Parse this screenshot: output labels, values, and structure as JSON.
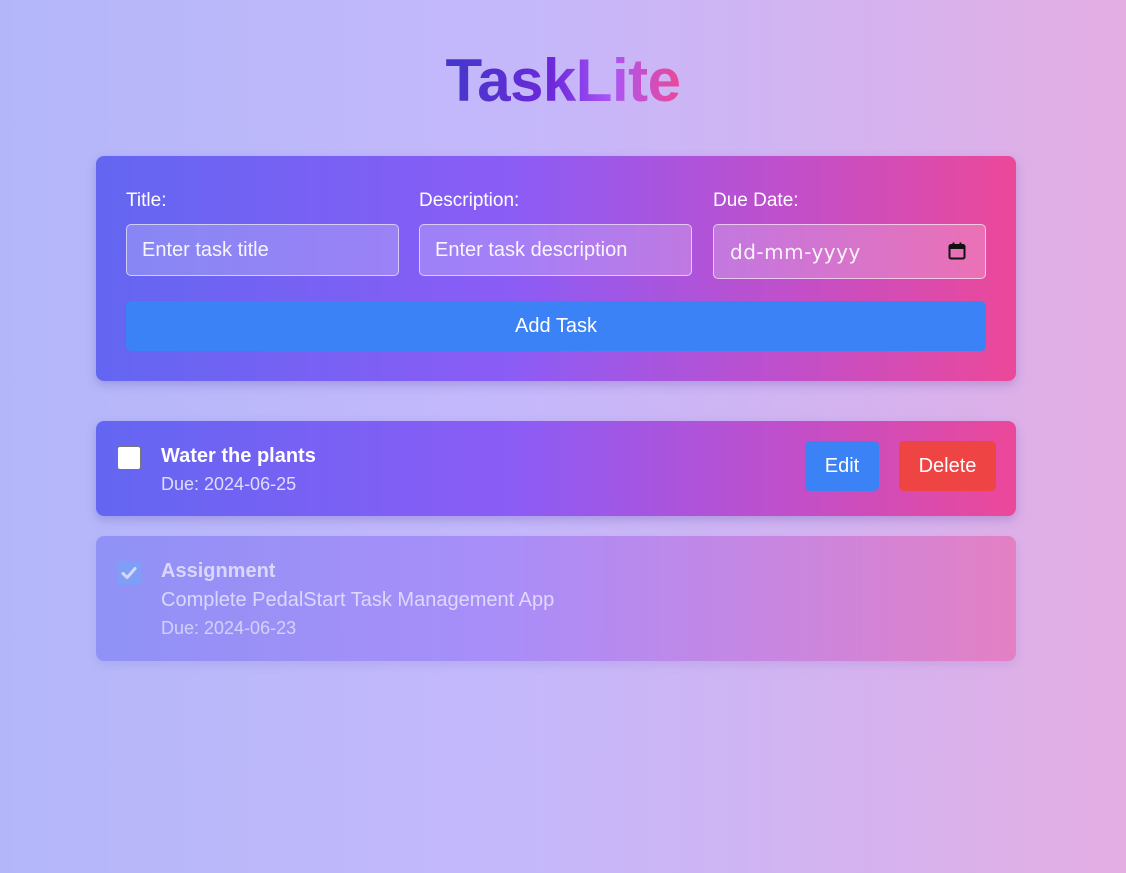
{
  "app": {
    "title": "TaskLite"
  },
  "form": {
    "title_label": "Title:",
    "title_placeholder": "Enter task title",
    "description_label": "Description:",
    "description_placeholder": "Enter task description",
    "due_label": "Due Date:",
    "due_placeholder": "dd-mm-yyyy",
    "add_button": "Add Task"
  },
  "tasks": [
    {
      "title": "Water the plants",
      "description": "",
      "due": "Due: 2024-06-25",
      "completed": false,
      "edit_label": "Edit",
      "delete_label": "Delete"
    },
    {
      "title": "Assignment",
      "description": "Complete PedalStart Task Management App",
      "due": "Due: 2024-06-23",
      "completed": true
    }
  ],
  "colors": {
    "primary_button": "#3b82f6",
    "danger_button": "#ef4444",
    "panel_gradient_start": "#6366f1",
    "panel_gradient_mid": "#8b5cf6",
    "panel_gradient_end": "#ec4899"
  },
  "icons": {
    "date_picker": "calendar-icon",
    "checkmark": "check-icon"
  }
}
